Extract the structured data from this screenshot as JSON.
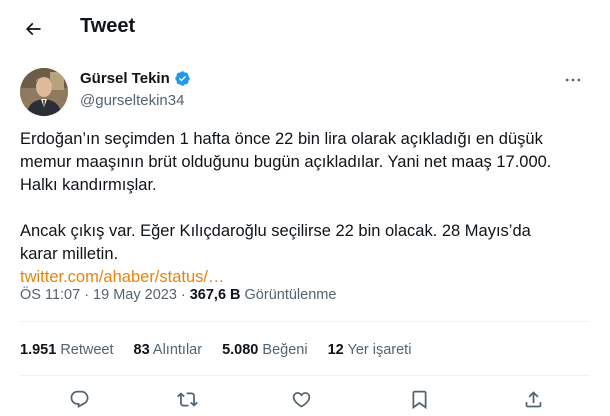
{
  "header": {
    "title": "Tweet",
    "back_icon": "arrow-left-icon"
  },
  "author": {
    "display_name": "Gürsel Tekin",
    "handle": "@gurseltekin34",
    "verified_icon": "verified-badge-icon",
    "more_icon": "more-horizontal-icon",
    "colors": {
      "verified": "#1d9bf0"
    }
  },
  "tweet": {
    "lines": [
      "Erdoğan’ın seçimden 1 hafta önce 22 bin lira olarak açıkladığı en düşük",
      "memur maaşının brüt olduğunu bugün açıkladılar. Yani net maaş 17.000.",
      "Halkı kandırmışlar.",
      "Ancak çıkış var. Eğer Kılıçdaroğlu seçilirse 22 bin olacak. 28 Mayıs’da",
      "karar milletin."
    ],
    "link": "twitter.com/ahaber/status/…",
    "colors": {
      "link": "#e8830c"
    }
  },
  "meta": {
    "time": "ÖS 11:07",
    "date": "19 May 2023",
    "views_count": "367,6 B",
    "views_label": "Görüntülenme"
  },
  "stats": {
    "retweets_count": "1.951",
    "retweets_label": "Retweet",
    "quotes_count": "83",
    "quotes_label": "Alıntılar",
    "likes_count": "5.080",
    "likes_label": "Beğeni",
    "bookmarks_count": "12",
    "bookmarks_label": "Yer işareti"
  },
  "actions": [
    "reply-icon",
    "retweet-icon",
    "like-icon",
    "bookmark-icon",
    "share-icon"
  ]
}
